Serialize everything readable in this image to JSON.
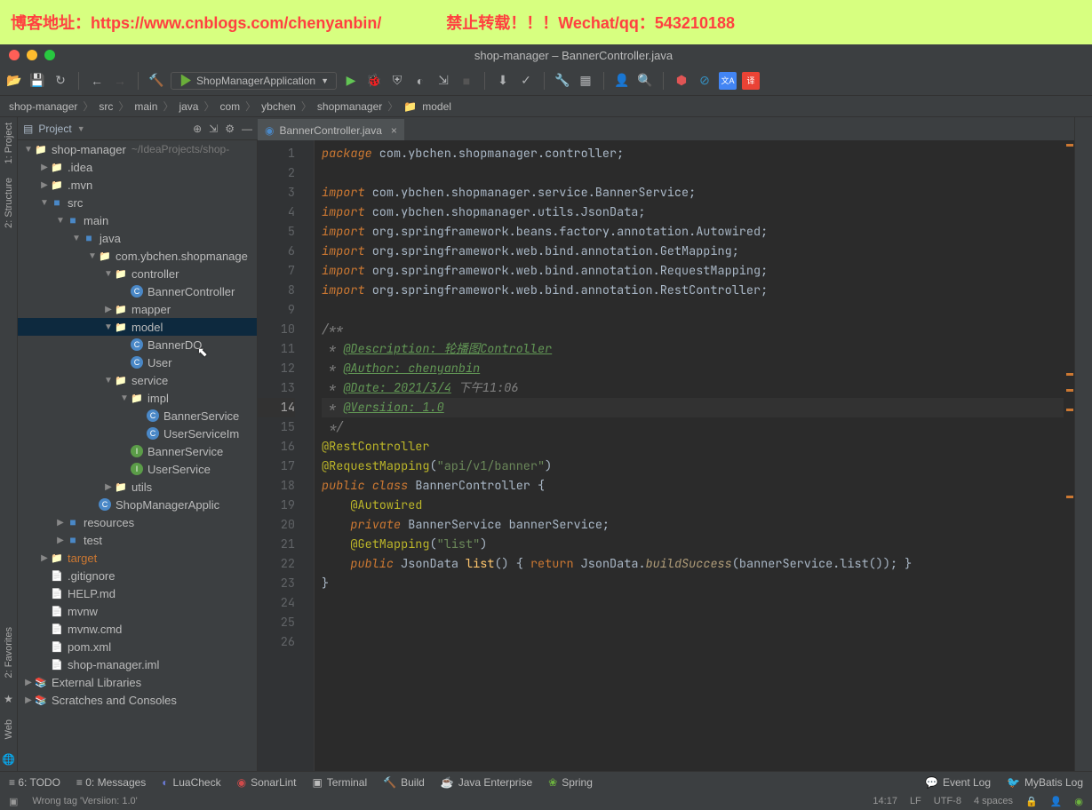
{
  "watermark": {
    "left": "博客地址：https://www.cnblogs.com/chenyanbin/",
    "right": "禁止转载！！！Wechat/qq：543210188"
  },
  "window_title": "shop-manager – BannerController.java",
  "run_config": "ShopManagerApplication",
  "breadcrumb": [
    "shop-manager",
    "src",
    "main",
    "java",
    "com",
    "ybchen",
    "shopmanager",
    "model"
  ],
  "project": {
    "title": "Project",
    "root": "shop-manager",
    "root_hint": "~/IdeaProjects/shop-manager",
    "tree": [
      {
        "d": 0,
        "t": "dir",
        "name": "shop-manager",
        "open": true,
        "hint": "~/IdeaProjects/shop-"
      },
      {
        "d": 1,
        "t": "dir",
        "name": ".idea",
        "open": false
      },
      {
        "d": 1,
        "t": "dir",
        "name": ".mvn",
        "open": false
      },
      {
        "d": 1,
        "t": "mod",
        "name": "src",
        "open": true
      },
      {
        "d": 2,
        "t": "mod",
        "name": "main",
        "open": true
      },
      {
        "d": 3,
        "t": "mod",
        "name": "java",
        "open": true
      },
      {
        "d": 4,
        "t": "dir",
        "name": "com.ybchen.shopmanage",
        "open": true
      },
      {
        "d": 5,
        "t": "dir",
        "name": "controller",
        "open": true
      },
      {
        "d": 6,
        "t": "cls",
        "name": "BannerController"
      },
      {
        "d": 5,
        "t": "dir",
        "name": "mapper",
        "open": false
      },
      {
        "d": 5,
        "t": "dir",
        "name": "model",
        "open": true,
        "selected": true
      },
      {
        "d": 6,
        "t": "cls",
        "name": "BannerDO"
      },
      {
        "d": 6,
        "t": "cls",
        "name": "User"
      },
      {
        "d": 5,
        "t": "dir",
        "name": "service",
        "open": true
      },
      {
        "d": 6,
        "t": "dir",
        "name": "impl",
        "open": true
      },
      {
        "d": 7,
        "t": "cls",
        "name": "BannerService"
      },
      {
        "d": 7,
        "t": "cls",
        "name": "UserServiceIm"
      },
      {
        "d": 6,
        "t": "int",
        "name": "BannerService"
      },
      {
        "d": 6,
        "t": "int",
        "name": "UserService"
      },
      {
        "d": 5,
        "t": "dir",
        "name": "utils",
        "open": false
      },
      {
        "d": 4,
        "t": "cls",
        "name": "ShopManagerApplic"
      },
      {
        "d": 2,
        "t": "mod",
        "name": "resources",
        "open": false
      },
      {
        "d": 2,
        "t": "mod",
        "name": "test",
        "open": false
      },
      {
        "d": 1,
        "t": "dir",
        "name": "target",
        "excluded": true,
        "open": false
      },
      {
        "d": 1,
        "t": "fil",
        "name": ".gitignore"
      },
      {
        "d": 1,
        "t": "fil",
        "name": "HELP.md"
      },
      {
        "d": 1,
        "t": "fil",
        "name": "mvnw"
      },
      {
        "d": 1,
        "t": "fil",
        "name": "mvnw.cmd"
      },
      {
        "d": 1,
        "t": "fil",
        "name": "pom.xml"
      },
      {
        "d": 1,
        "t": "fil",
        "name": "shop-manager.iml"
      }
    ],
    "external": "External Libraries",
    "scratches": "Scratches and Consoles"
  },
  "tab": {
    "name": "BannerController.java"
  },
  "code_lines": [
    "<span class='kw'>package</span> com.ybchen.shopmanager.controller;",
    "",
    "<span class='kw'>import</span> com.ybchen.shopmanager.service.BannerService;",
    "<span class='kw'>import</span> com.ybchen.shopmanager.utils.JsonData;",
    "<span class='kw'>import</span> org.springframework.beans.factory.annotation.Autowired;",
    "<span class='kw'>import</span> org.springframework.web.bind.annotation.GetMapping;",
    "<span class='kw'>import</span> org.springframework.web.bind.annotation.RequestMapping;",
    "<span class='kw'>import</span> org.springframework.web.bind.annotation.RestController;",
    "",
    "<span class='cmt'>/**</span>",
    "<span class='cmt'> * </span><span class='doc'>@Description: 轮播图Controller</span>",
    "<span class='cmt'> * </span><span class='doc'>@Author: chenyanbin</span>",
    "<span class='cmt'> * </span><span class='doc'>@Date: 2021/3/4</span> <span class='cmt'>下午11:06</span>",
    "<span class='cmt'> * </span><span class='doc'>@Versiion: 1.0</span>",
    "<span class='cmt'> */</span>",
    "<span class='anno'>@RestController</span>",
    "<span class='anno'>@RequestMapping</span>(<span class='str'>\"api/v1/banner\"</span>)",
    "<span class='kw'>public class</span> <span class='cls-n'>BannerController</span> {",
    "    <span class='anno'>@Autowired</span>",
    "    <span class='kw'>private</span> <span class='typ'>BannerService</span> bannerService;",
    "    <span class='anno'>@GetMapping</span>(<span class='str'>\"list\"</span>)",
    "    <span class='kw'>public</span> <span class='typ'>JsonData</span> <span class='fn'>list</span>() { <span class='kw2'>return</span> JsonData.<span class='fn2'>buildSuccess</span>(bannerService.list()); }",
    "}",
    "",
    "",
    ""
  ],
  "line_count": 26,
  "current_line": 14,
  "bottom_tools": [
    "≡ 6: TODO",
    "≡ 0: Messages",
    "LuaCheck",
    "SonarLint",
    "Terminal",
    "Build",
    "Java Enterprise",
    "Spring"
  ],
  "bottom_right": [
    "Event Log",
    "MyBatis Log"
  ],
  "status": {
    "msg": "Wrong tag 'Versiion:  1.0'",
    "cursor": "14:17",
    "lineend": "LF",
    "encoding": "UTF-8",
    "indent": "4 spaces"
  },
  "left_tabs": [
    "1: Project",
    "2: Structure",
    "2: Favorites",
    "Web"
  ]
}
